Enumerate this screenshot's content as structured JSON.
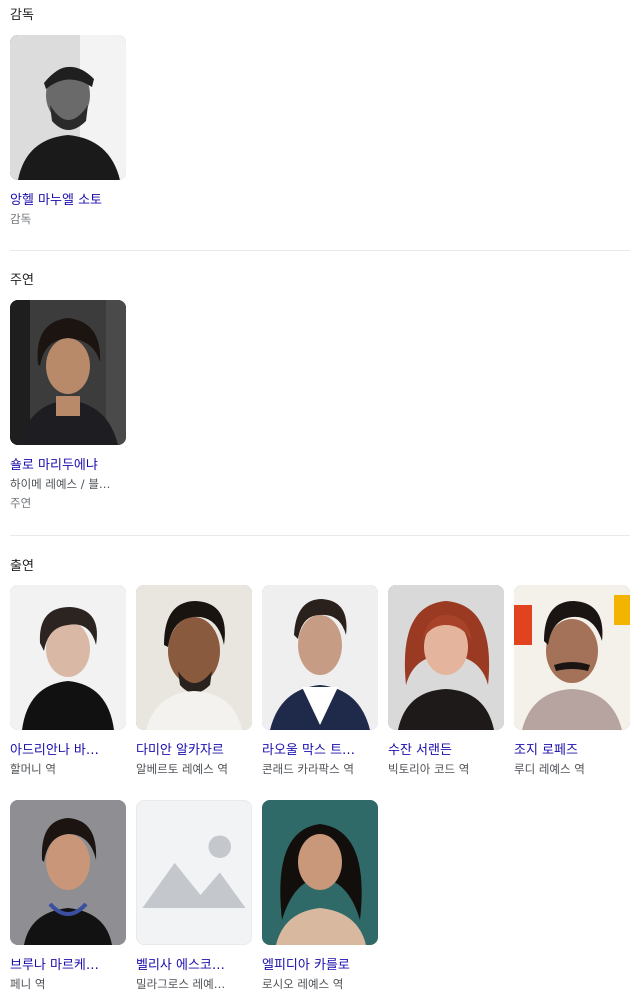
{
  "director": {
    "title": "감독",
    "people": [
      {
        "name": "앙헬 마누엘 소토",
        "role": "감독"
      }
    ]
  },
  "lead": {
    "title": "주연",
    "people": [
      {
        "name": "숄로 마리두에냐",
        "role": "하이메 레예스 / 블…",
        "meta": "주연"
      }
    ]
  },
  "cast": {
    "title": "출연",
    "people": [
      {
        "name": "아드리안나 바…",
        "role": "할머니 역"
      },
      {
        "name": "다미안 알카자르",
        "role": "알베르토 레예스 역"
      },
      {
        "name": "라오울 막스 트…",
        "role": "콘래드 카라팍스 역"
      },
      {
        "name": "수잔 서랜든",
        "role": "빅토리아 코드 역"
      },
      {
        "name": "조지 로페즈",
        "role": "루디 레예스 역"
      },
      {
        "name": "브루나 마르케…",
        "role": "페니 역"
      },
      {
        "name": "벨리사 에스코…",
        "role": "밀라그로스 레예…"
      },
      {
        "name": "엘피디아 카를로",
        "role": "로시오 레예스 역"
      }
    ]
  },
  "colors": {
    "link": "#1a0dab",
    "text": "#202124",
    "muted": "#70757a",
    "divider": "#e8eaed"
  }
}
